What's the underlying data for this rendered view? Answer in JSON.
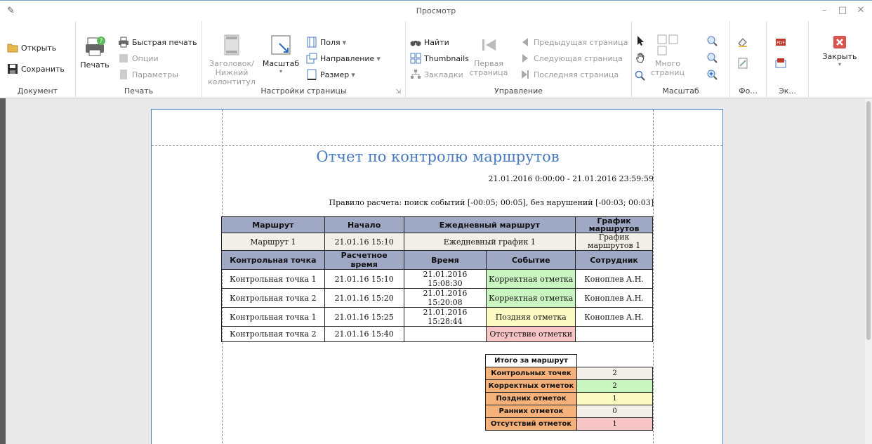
{
  "window": {
    "title": "Просмотр"
  },
  "ribbon": {
    "document": {
      "label": "Документ",
      "open": "Открыть",
      "save": "Сохранить"
    },
    "print": {
      "label": "Печать",
      "print": "Печать",
      "quick_print": "Быстрая печать",
      "options": "Опции",
      "parameters": "Параметры"
    },
    "page_setup": {
      "label": "Настройки страницы",
      "header_footer_line1": "Заголовок/Нижний",
      "header_footer_line2": "колонтитул",
      "scale": "Масштаб",
      "margins": "Поля",
      "orientation": "Направление",
      "size": "Размер"
    },
    "navigation": {
      "label": "Управление",
      "find": "Найти",
      "thumbnails": "Thumbnails",
      "bookmarks": "Закладки",
      "first_page_line1": "Первая",
      "first_page_line2": "страница",
      "prev_page": "Предыдущая страница",
      "next_page": "Следующая страница",
      "last_page": "Последняя страница"
    },
    "zoom": {
      "label": "Масштаб",
      "many_pages_line1": "Много",
      "many_pages_line2": "страниц"
    },
    "background": {
      "label": "Фо..."
    },
    "export": {
      "label": "Эк..."
    },
    "close": {
      "label": "Закрыть"
    }
  },
  "report": {
    "title": "Отчет по контролю маршрутов",
    "date_range": "21.01.2016 0:00:00 - 21.01.2016 23:59:59",
    "rule": "Правило расчета: поиск событий [-00:05; 00:05], без нарушений [-00:03; 00:03]",
    "header1": {
      "route": "Маршрут",
      "start": "Начало",
      "daily_route": "Ежедневный маршрут",
      "schedule": "График маршрутов"
    },
    "route_row": {
      "route": "Маршрут 1",
      "start": "21.01.16 15:10",
      "daily_route": "Ежедневный график 1",
      "schedule": "График маршрутов 1"
    },
    "header2": {
      "checkpoint": "Контрольная точка",
      "calc_time": "Расчетное время",
      "time": "Время",
      "event": "Событие",
      "employee": "Сотрудник"
    },
    "rows": [
      {
        "checkpoint": "Контрольная точка 1",
        "calc_time": "21.01.16 15:10",
        "time": "21.01.2016 15:08:30",
        "event": "Корректная отметка",
        "employee": "Коноплев А.Н."
      },
      {
        "checkpoint": "Контрольная точка 2",
        "calc_time": "21.01.16 15:20",
        "time": "21.01.2016 15:20:08",
        "event": "Корректная отметка",
        "employee": "Коноплев А.Н."
      },
      {
        "checkpoint": "Контрольная точка 1",
        "calc_time": "21.01.16 15:25",
        "time": "21.01.2016 15:28:44",
        "event": "Поздняя отметка",
        "employee": "Коноплев А.Н."
      },
      {
        "checkpoint": "Контрольная точка 2",
        "calc_time": "21.01.16 15:40",
        "time": "",
        "event": "Отсутствие отметки",
        "employee": ""
      }
    ],
    "summary": {
      "title": "Итого за маршрут",
      "items": [
        {
          "label": "Контрольных точек",
          "value": "2"
        },
        {
          "label": "Корректных отметок",
          "value": "2"
        },
        {
          "label": "Поздних отметок",
          "value": "1"
        },
        {
          "label": "Ранних отметок",
          "value": "0"
        },
        {
          "label": "Отсутствий отметок",
          "value": "1"
        }
      ]
    }
  },
  "colors": {
    "accent": "#4a7bbf",
    "header_bg": "#9fa9c6",
    "ok": "#c8f5c0",
    "late": "#fafac2",
    "missing": "#f7c5c5",
    "summary_label": "#f4b27a"
  }
}
